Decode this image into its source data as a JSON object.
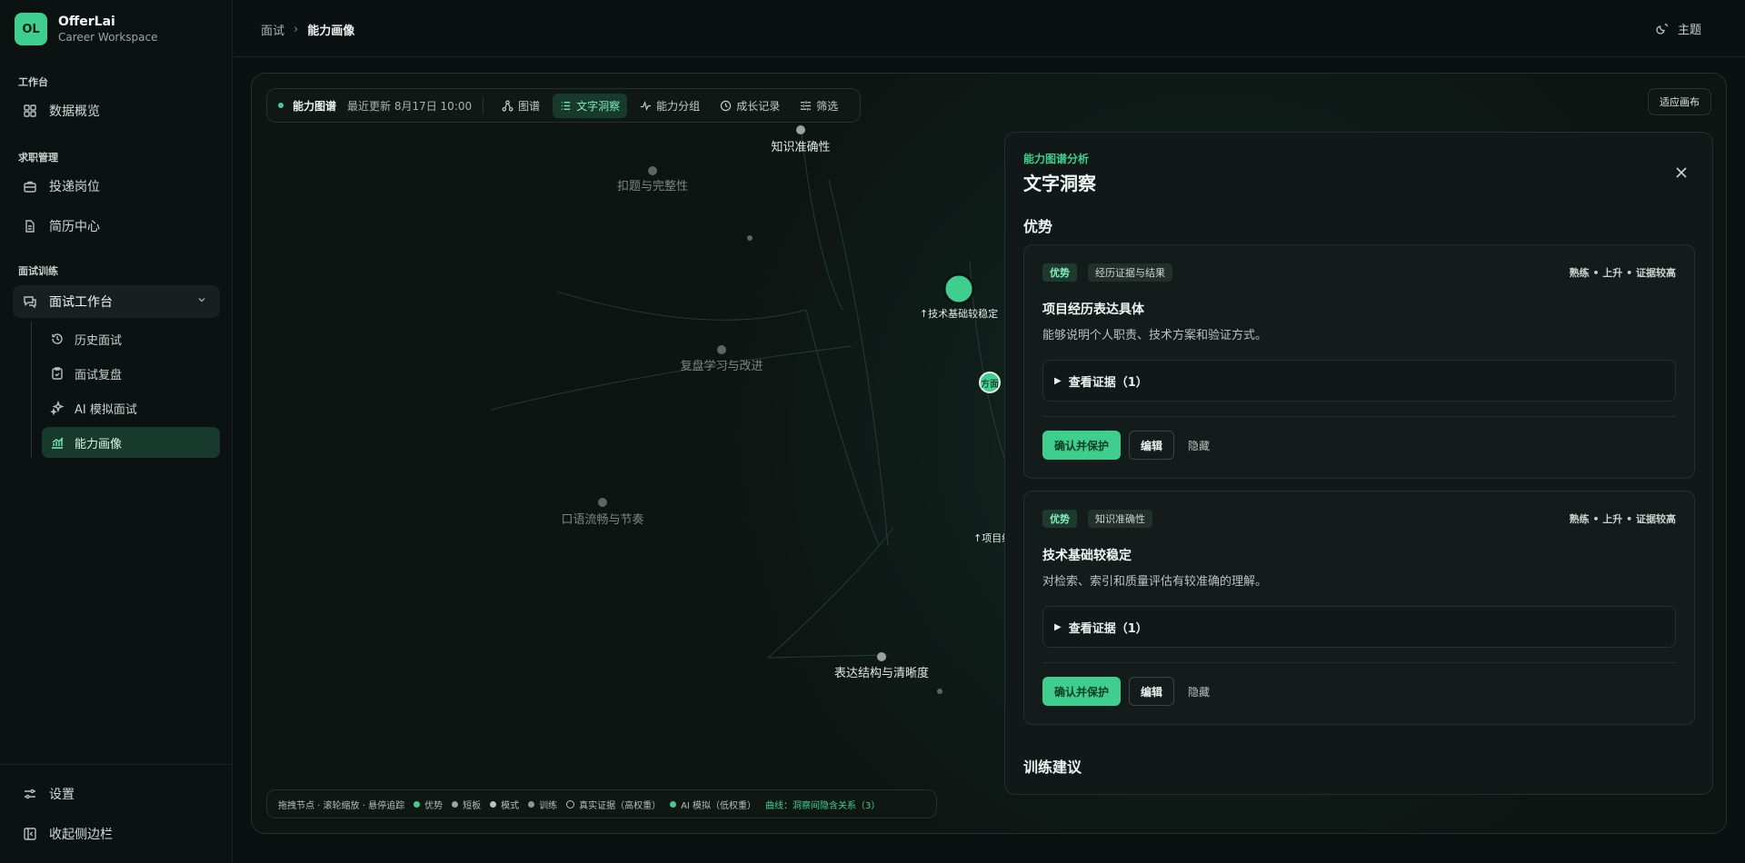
{
  "brand": {
    "logo": "OL",
    "name": "OfferLai",
    "subtitle": "Career Workspace"
  },
  "sidebar": {
    "sections": [
      "工作台",
      "求职管理",
      "面试训练"
    ],
    "items": [
      {
        "label": "数据概览",
        "icon": "grid-icon"
      },
      {
        "label": "投递岗位",
        "icon": "briefcase-icon"
      },
      {
        "label": "简历中心",
        "icon": "document-icon"
      }
    ],
    "group": {
      "label": "面试工作台",
      "icon": "chat-icon"
    },
    "sub_items": [
      {
        "label": "历史面试",
        "icon": "history-icon"
      },
      {
        "label": "面试复盘",
        "icon": "clipboard-icon"
      },
      {
        "label": "AI 模拟面试",
        "icon": "sparkle-icon"
      },
      {
        "label": "能力画像",
        "icon": "chart-icon",
        "active": true
      }
    ],
    "settings": "设置",
    "collapse": "收起侧边栏"
  },
  "topbar": {
    "crumb_parent": "面试",
    "crumb_current": "能力画像",
    "theme": "主题"
  },
  "toolbar": {
    "title": "能力图谱",
    "updated": "最近更新 8月17日 10:00",
    "buttons": [
      "图谱",
      "文字洞察",
      "能力分组",
      "成长记录",
      "筛选"
    ],
    "active": "文字洞察",
    "fit": "适应画布"
  },
  "graph": {
    "nodes": [
      "知识准确性",
      "扣题与完整性",
      "↑技术基础较稳定",
      "复盘学习与改进",
      "口语流畅与节奏",
      "表达结构与清晰度",
      "↑项目经",
      "方面"
    ]
  },
  "legend": {
    "hint": "拖拽节点 · 滚轮缩放 · 悬停追踪",
    "items": [
      "优势",
      "短板",
      "模式",
      "训练",
      "真实证据（高权重）",
      "AI 模拟（低权重）"
    ],
    "curve": "曲线：洞察间隐含关系（3）",
    "colors": {
      "strength": "#3ecf8e",
      "weakness": "#9aa39f",
      "pattern": "#b9c2be",
      "training": "#8c9692"
    }
  },
  "drawer": {
    "kicker": "能力图谱分析",
    "title": "文字洞察",
    "section_strengths": "优势",
    "section_training": "训练建议",
    "cards": [
      {
        "tag": "优势",
        "category": "经历证据与结果",
        "meta": "熟练 • 上升 • 证据较高",
        "title": "项目经历表达具体",
        "desc": "能够说明个人职责、技术方案和验证方式。",
        "evidence": "查看证据（1）",
        "confirm": "确认并保护",
        "edit": "编辑",
        "hide": "隐藏"
      },
      {
        "tag": "优势",
        "category": "知识准确性",
        "meta": "熟练 • 上升 • 证据较高",
        "title": "技术基础较稳定",
        "desc": "对检索、索引和质量评估有较准确的理解。",
        "evidence": "查看证据（1）",
        "confirm": "确认并保护",
        "edit": "编辑",
        "hide": "隐藏"
      }
    ]
  },
  "colors": {
    "accent": "#3ecf8e",
    "background": "#0b1110"
  }
}
